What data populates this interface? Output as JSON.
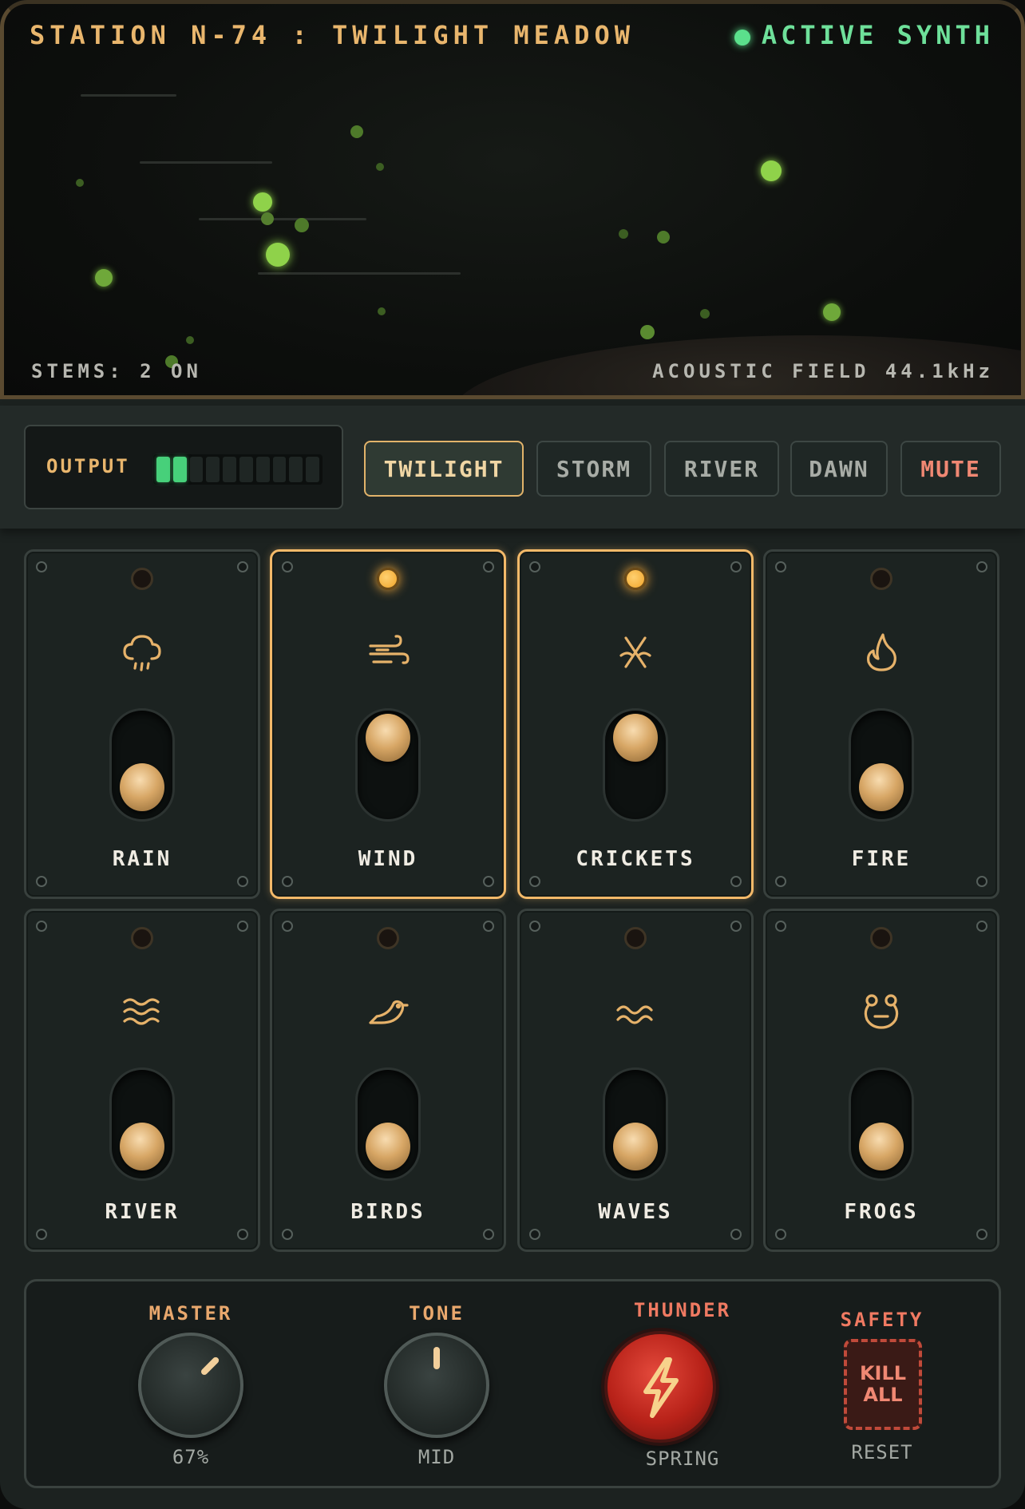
{
  "display": {
    "title": "STATION N-74 : TWILIGHT MEADOW",
    "status": "ACTIVE SYNTH",
    "stems": "STEMS: 2 ON",
    "field": "ACOUSTIC FIELD 44.1kHz"
  },
  "output": {
    "label": "OUTPUT",
    "level_segments_on": 2,
    "segments_total": 10
  },
  "presets": [
    {
      "label": "TWILIGHT",
      "active": true
    },
    {
      "label": "STORM",
      "active": false
    },
    {
      "label": "RIVER",
      "active": false
    },
    {
      "label": "DAWN",
      "active": false
    },
    {
      "label": "MUTE",
      "active": false
    }
  ],
  "stems": [
    {
      "label": "RAIN",
      "on": false,
      "icon": "cloud-rain-icon"
    },
    {
      "label": "WIND",
      "on": true,
      "icon": "wind-icon"
    },
    {
      "label": "CRICKETS",
      "on": true,
      "icon": "cricket-icon"
    },
    {
      "label": "FIRE",
      "on": false,
      "icon": "flame-icon"
    },
    {
      "label": "RIVER",
      "on": false,
      "icon": "waves-icon"
    },
    {
      "label": "BIRDS",
      "on": false,
      "icon": "bird-icon"
    },
    {
      "label": "WAVES",
      "on": false,
      "icon": "ocean-wave-icon"
    },
    {
      "label": "FROGS",
      "on": false,
      "icon": "frog-icon"
    }
  ],
  "controls": {
    "master": {
      "title": "MASTER",
      "value": "67%"
    },
    "tone": {
      "title": "TONE",
      "value": "MID"
    },
    "thunder": {
      "title": "THUNDER",
      "value": "SPRING"
    },
    "safety": {
      "title": "SAFETY",
      "button_line1": "KILL",
      "button_line2": "ALL",
      "value": "RESET"
    }
  },
  "colors": {
    "accent": "#e9b66d",
    "active_green": "#6ee09a",
    "firefly": "#8fd24a",
    "danger": "#f08873"
  }
}
